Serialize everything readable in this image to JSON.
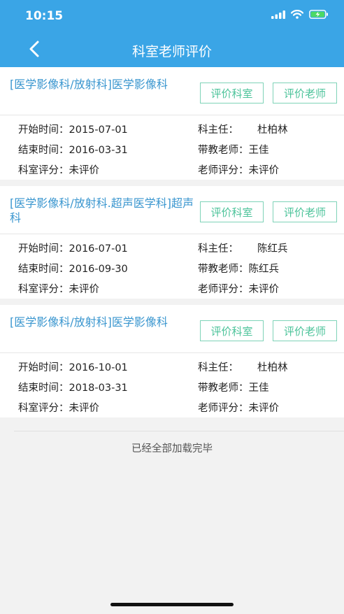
{
  "status": {
    "time": "10:15"
  },
  "nav": {
    "title": "科室老师评价"
  },
  "records": [
    {
      "dept": "[医学影像科/放射科]医学影像科",
      "rate_dept": "评价科室",
      "rate_teacher": "评价老师",
      "start": "开始时间：2015-07-01",
      "end": "结束时间：2016-03-31",
      "dept_score": "科室评分：未评价",
      "director_label": "科主任：",
      "director": "杜柏林",
      "teacher": "带教老师：王佳",
      "teacher_score": "老师评分：未评价"
    },
    {
      "dept": "[医学影像科/放射科.超声医学科]超声科",
      "rate_dept": "评价科室",
      "rate_teacher": "评价老师",
      "start": "开始时间：2016-07-01",
      "end": "结束时间：2016-09-30",
      "dept_score": "科室评分：未评价",
      "director_label": "科主任：",
      "director": "陈红兵",
      "teacher": "带教老师：陈红兵",
      "teacher_score": "老师评分：未评价"
    },
    {
      "dept": "[医学影像科/放射科]医学影像科",
      "rate_dept": "评价科室",
      "rate_teacher": "评价老师",
      "start": "开始时间：2016-10-01",
      "end": "结束时间：2018-03-31",
      "dept_score": "科室评分：未评价",
      "director_label": "科主任：",
      "director": "杜柏林",
      "teacher": "带教老师：王佳",
      "teacher_score": "老师评分：未评价"
    }
  ],
  "footer": {
    "end_message": "已经全部加载完毕"
  },
  "colors": {
    "header": "#3aa5e6",
    "title_blue": "#3a96cf",
    "button_green": "#4cc39a"
  }
}
